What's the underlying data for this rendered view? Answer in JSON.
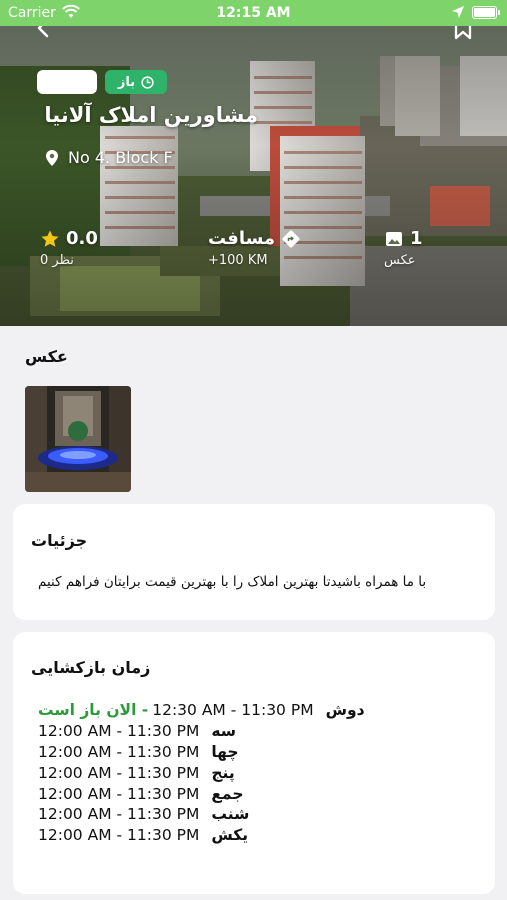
{
  "status_bar": {
    "carrier": "Carrier",
    "time": "12:15 AM"
  },
  "header": {
    "open_badge": "باز",
    "title": "مشاورین املاک آلانیا",
    "address": "No 4. Block F",
    "accent_color": "#2fb36a"
  },
  "stats": {
    "rating_value": "0.0",
    "rating_count": "0 نظر",
    "distance_label": "مسافت",
    "distance_value": "+100 KM",
    "photos_count": "1",
    "photos_label": "عکس"
  },
  "photos_section": {
    "title": "عکس"
  },
  "details": {
    "title": "جزئیات",
    "description": "با ما همراه باشیدتا بهترین املاک را با بهترین قیمت برایتان فراهم کنیم"
  },
  "opening_hours": {
    "title": "زمان بازکشایی",
    "open_now": "- الان باز است",
    "rows": [
      {
        "day": "دوش",
        "time": "12:30 AM - 11:30 PM"
      },
      {
        "day": "سه",
        "time": "12:00 AM - 11:30 PM"
      },
      {
        "day": "چها",
        "time": "12:00 AM - 11:30 PM"
      },
      {
        "day": "پنج",
        "time": "12:00 AM - 11:30 PM"
      },
      {
        "day": "جمع",
        "time": "12:00 AM - 11:30 PM"
      },
      {
        "day": "شنب",
        "time": "12:00 AM - 11:30 PM"
      },
      {
        "day": "یکش",
        "time": "12:00 AM - 11:30 PM"
      }
    ]
  }
}
